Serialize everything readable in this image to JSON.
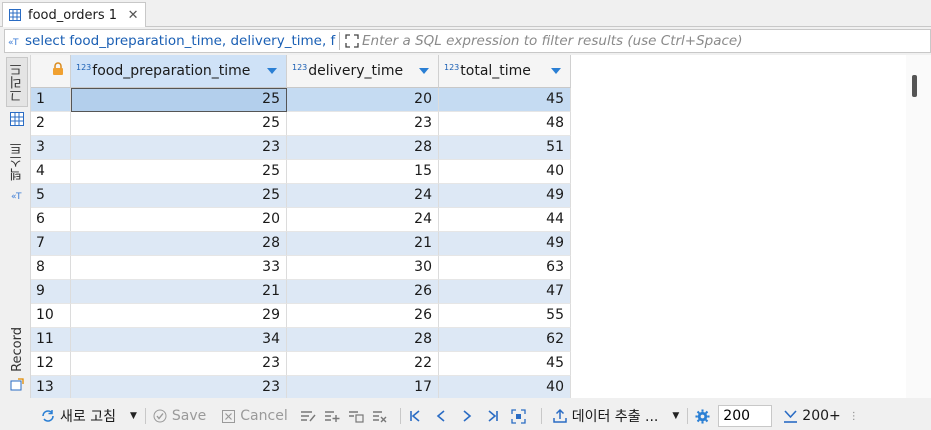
{
  "tab": {
    "label": "food_orders 1",
    "close": "✕"
  },
  "query": {
    "text": "select food_preparation_time, delivery_time, f",
    "filter_placeholder": "Enter a SQL expression to filter results (use Ctrl+Space)"
  },
  "left_panel": {
    "grid_label": "그리드",
    "text_label": "텍스트",
    "record_label": "Record"
  },
  "columns": [
    {
      "type": "123",
      "name": "food_preparation_time"
    },
    {
      "type": "123",
      "name": "delivery_time"
    },
    {
      "type": "123",
      "name": "total_time"
    }
  ],
  "rows": [
    {
      "n": "1",
      "c": [
        "25",
        "20",
        "45"
      ]
    },
    {
      "n": "2",
      "c": [
        "25",
        "23",
        "48"
      ]
    },
    {
      "n": "3",
      "c": [
        "23",
        "28",
        "51"
      ]
    },
    {
      "n": "4",
      "c": [
        "25",
        "15",
        "40"
      ]
    },
    {
      "n": "5",
      "c": [
        "25",
        "24",
        "49"
      ]
    },
    {
      "n": "6",
      "c": [
        "20",
        "24",
        "44"
      ]
    },
    {
      "n": "7",
      "c": [
        "28",
        "21",
        "49"
      ]
    },
    {
      "n": "8",
      "c": [
        "33",
        "30",
        "63"
      ]
    },
    {
      "n": "9",
      "c": [
        "21",
        "26",
        "47"
      ]
    },
    {
      "n": "10",
      "c": [
        "29",
        "26",
        "55"
      ]
    },
    {
      "n": "11",
      "c": [
        "34",
        "28",
        "62"
      ]
    },
    {
      "n": "12",
      "c": [
        "23",
        "22",
        "45"
      ]
    },
    {
      "n": "13",
      "c": [
        "23",
        "17",
        "40"
      ]
    }
  ],
  "toolbar": {
    "refresh": "새로 고침",
    "save": "Save",
    "cancel": "Cancel",
    "export": "데이터 추출 ...",
    "fetch_size": "200",
    "fetch_more": "200+"
  }
}
